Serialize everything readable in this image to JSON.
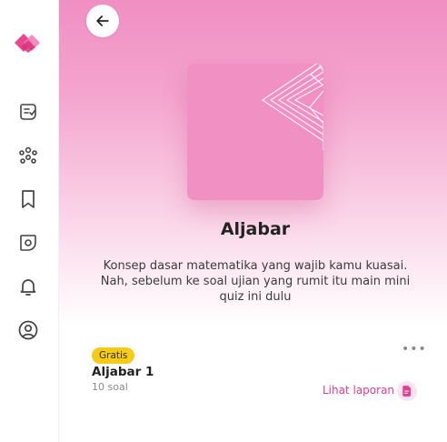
{
  "brand": {
    "logo_icon": "brand-logo-icon",
    "accent": "#e9488f"
  },
  "sidebar": {
    "items": [
      {
        "name": "quiz",
        "icon": "quiz-icon"
      },
      {
        "name": "groups",
        "icon": "people-icon"
      },
      {
        "name": "saved",
        "icon": "bookmark-icon"
      },
      {
        "name": "explore",
        "icon": "compass-icon"
      },
      {
        "name": "notifications",
        "icon": "bell-icon"
      },
      {
        "name": "profile",
        "icon": "user-circle-icon"
      }
    ]
  },
  "header": {
    "back_icon": "arrow-left-icon"
  },
  "topic": {
    "title": "Aljabar",
    "description": "Konsep dasar matematika yang wajib kamu kuasai. Nah, sebelum ke soal ujian yang rumit itu main mini quiz ini dulu",
    "cover_color": "#f090c3"
  },
  "quiz_card": {
    "badge": "Gratis",
    "badge_color": "#f6cb18",
    "title": "Aljabar 1",
    "count": "10 soal",
    "more_label": "•••",
    "report_label": "Lihat laporan",
    "report_icon": "report-document-icon"
  }
}
